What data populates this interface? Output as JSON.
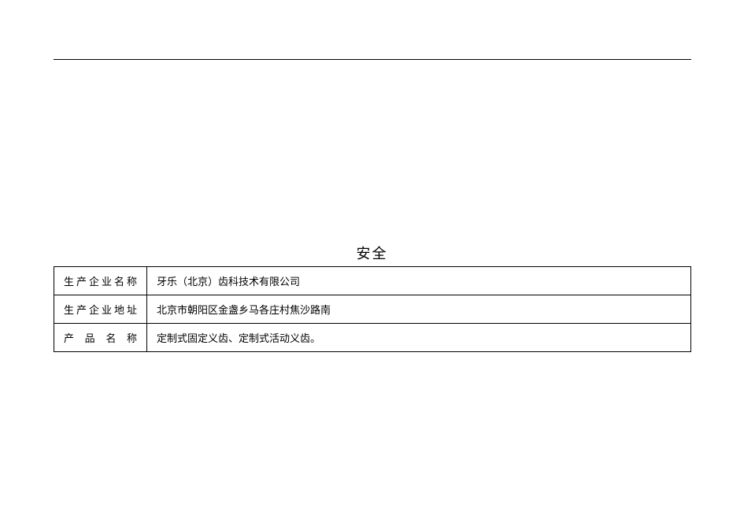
{
  "title": "安全",
  "rows": [
    {
      "label": "生产企业名称",
      "value": "牙乐（北京）齿科技术有限公司"
    },
    {
      "label": "生产企业地址",
      "value": "北京市朝阳区金盏乡马各庄村焦沙路南"
    },
    {
      "label": "产 品 名 称",
      "value": "定制式固定义齿、定制式活动义齿。"
    }
  ]
}
